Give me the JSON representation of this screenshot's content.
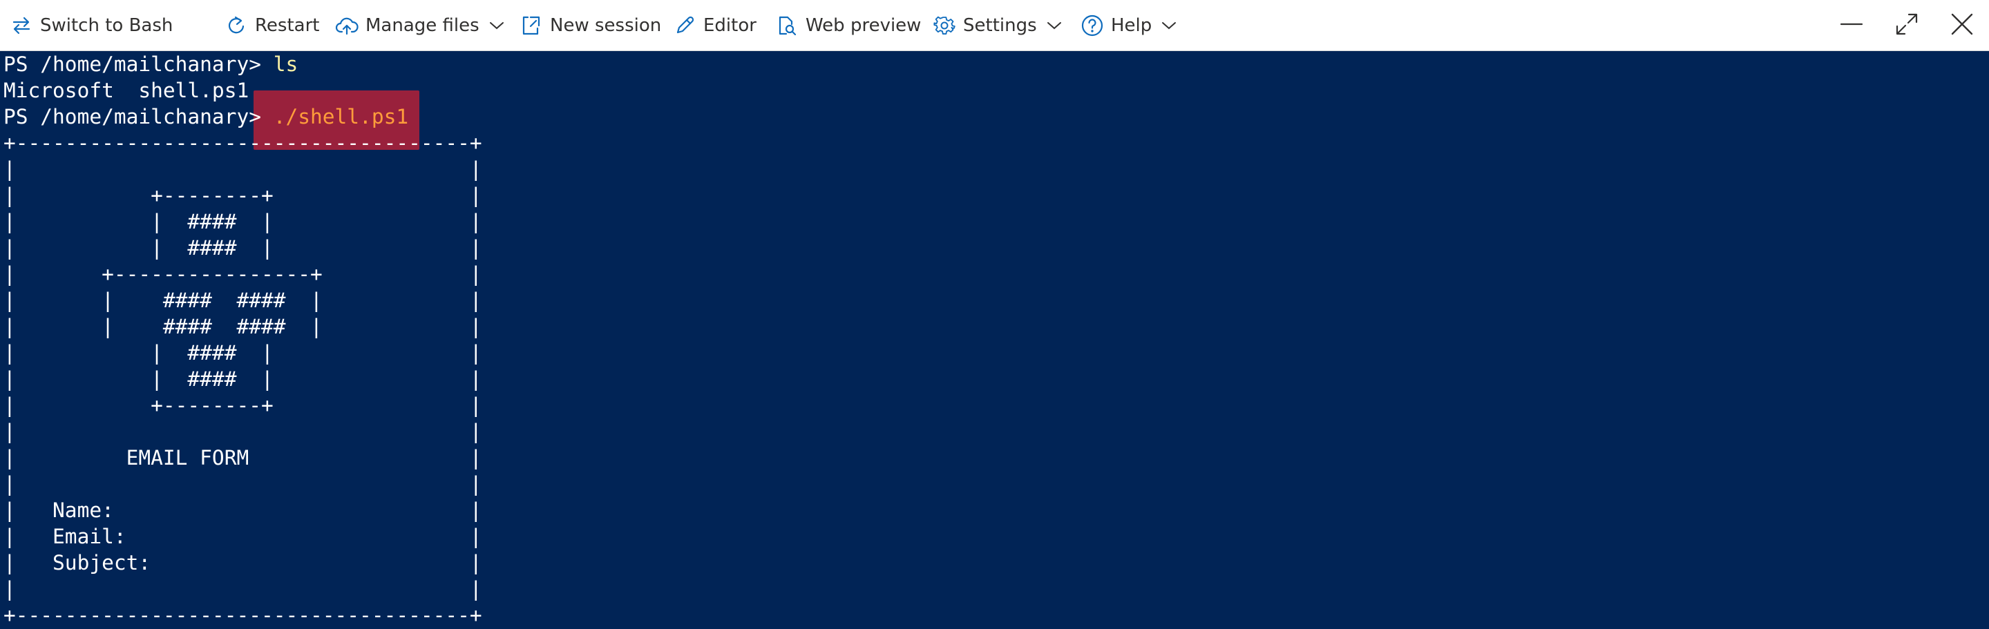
{
  "toolbar": {
    "switch_label": "Switch to Bash",
    "restart_label": "Restart",
    "manage_files_label": "Manage files",
    "new_session_label": "New session",
    "editor_label": "Editor",
    "web_preview_label": "Web preview",
    "settings_label": "Settings",
    "help_label": "Help"
  },
  "terminal": {
    "prompt": "PS /home/mailchanary> ",
    "cmd1": "ls",
    "ls_output": "Microsoft  shell.ps1",
    "cmd2": "./shell.ps1",
    "lines": [
      "+-------------------------------------+",
      "|                                     |",
      "|           +--------+                |",
      "|           |  ####  |                |",
      "|           |  ####  |                |",
      "|       +----------------+            |",
      "|       |    ####  ####  |            |",
      "|       |    ####  ####  |            |",
      "|           |  ####  |                |",
      "|           |  ####  |                |",
      "|           +--------+                |",
      "|                                     |",
      "|         EMAIL FORM                  |",
      "|                                     |",
      "|   Name:                             |",
      "|   Email:                            |",
      "|   Subject:                          |",
      "|                                     |",
      "+-------------------------------------+"
    ]
  },
  "colors": {
    "terminal_bg": "#012456",
    "command_yellow": "#f9f1a5",
    "command_orange": "#ff9d3b",
    "highlight": "#c42034"
  }
}
